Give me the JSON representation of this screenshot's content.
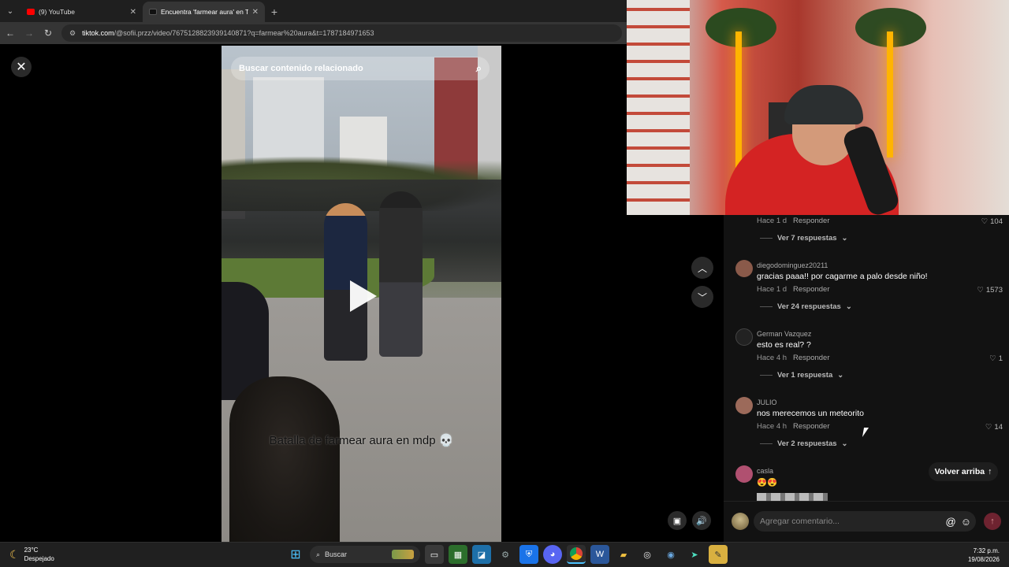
{
  "browser": {
    "tabs": [
      {
        "title": "(9) YouTube",
        "favicon_color": "#ff0000",
        "active": false
      },
      {
        "title": "Encuentra 'farmear aura' en TikTok",
        "favicon_color": "#111111",
        "active": true
      }
    ],
    "url_host": "tiktok.com",
    "url_path": "/@sofii.przz/video/7675128823939140871?q=farmear%20aura&t=1787184971653"
  },
  "video": {
    "search_placeholder": "Buscar contenido relacionado",
    "caption": "Batalla de farmear aura en mdp 💀"
  },
  "comments": [
    {
      "time": "Hace 1 d",
      "reply_label": "Responder",
      "likes": "104",
      "replies": "Ver 7 respuestas"
    },
    {
      "user": "diegodominguez20211",
      "text": "gracias paaa!! por cagarme a palo desde niño!",
      "time": "Hace 1 d",
      "reply_label": "Responder",
      "likes": "1573",
      "replies": "Ver 24 respuestas",
      "avatar_color": "#8a5a4a"
    },
    {
      "user": "German Vazquez",
      "text": "esto es real? ?",
      "time": "Hace 4 h",
      "reply_label": "Responder",
      "likes": "1",
      "replies": "Ver 1 respuesta",
      "avatar_color": "#222222"
    },
    {
      "user": "JULIO",
      "text": "nos merecemos un meteorito",
      "time": "Hace 4 h",
      "reply_label": "Responder",
      "likes": "14",
      "replies": "Ver 2 respuestas",
      "avatar_color": "#9c6a5a"
    },
    {
      "user": "casla",
      "text": "😍😍",
      "avatar_color": "#b05070"
    }
  ],
  "volver_arriba": "Volver arriba",
  "comment_input_placeholder": "Agregar comentario...",
  "taskbar": {
    "temp": "23°C",
    "weather": "Despejado",
    "search": "Buscar",
    "time": "7:32 p.m.",
    "date": "19/08/2026"
  },
  "colors": {
    "accent": "#fe2c55",
    "panel_bg": "#121212"
  }
}
